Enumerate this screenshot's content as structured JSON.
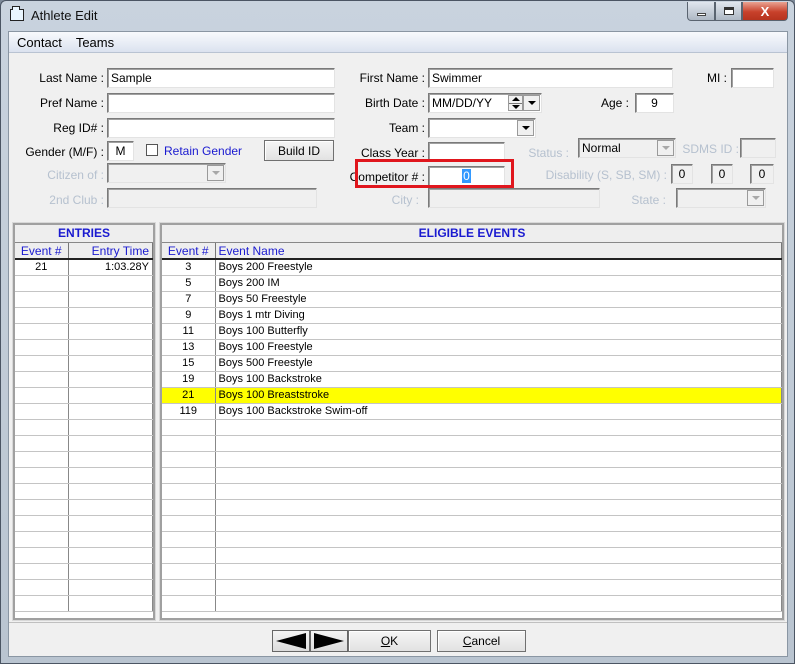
{
  "window": {
    "title": "Athlete Edit",
    "icon": "folder-window-icon",
    "controls": [
      "minimize-icon",
      "maximize-icon",
      "close-icon"
    ],
    "close_glyph": "X"
  },
  "menu": [
    {
      "label": "Contact"
    },
    {
      "label": "Teams"
    }
  ],
  "form": {
    "last_name": {
      "label": "Last Name :",
      "value": "Sample"
    },
    "first_name": {
      "label": "First Name :",
      "value": "Swimmer"
    },
    "mi": {
      "label": "MI :",
      "value": ""
    },
    "pref_name": {
      "label": "Pref Name :",
      "value": ""
    },
    "birth_date": {
      "label": "Birth Date :",
      "value": "MM/DD/YY"
    },
    "age": {
      "label": "Age :",
      "value": "9"
    },
    "reg_id": {
      "label": "Reg ID# :",
      "value": ""
    },
    "team": {
      "label": "Team :",
      "value": ""
    },
    "gender": {
      "label": "Gender (M/F) :",
      "value": "M"
    },
    "retain_gender": {
      "label": "Retain Gender",
      "checked": false
    },
    "build_id": {
      "label": "Build ID"
    },
    "class_year": {
      "label": "Class Year :",
      "value": ""
    },
    "status": {
      "label": "Status :",
      "value": "Normal",
      "disabled": true
    },
    "sdms_id": {
      "label": "SDMS ID :",
      "value": "",
      "disabled": true
    },
    "citizen_of": {
      "label": "Citizen of :",
      "value": "",
      "disabled": true
    },
    "competitor": {
      "label": "Competitor # :",
      "value": "0",
      "highlight_color": "#e0161d"
    },
    "disability": {
      "label": "Disability (S, SB, SM) :",
      "values": [
        "0",
        "0",
        "0"
      ],
      "disabled": true
    },
    "second_club": {
      "label": "2nd Club :",
      "value": "",
      "disabled": true
    },
    "city": {
      "label": "City :",
      "value": "",
      "disabled": true
    },
    "state": {
      "label": "State :",
      "value": "",
      "disabled": true
    }
  },
  "entries": {
    "title": "ENTRIES",
    "columns": [
      "Event #",
      "Entry Time"
    ],
    "rows": [
      {
        "event": "21",
        "time": "1:03.28Y"
      }
    ]
  },
  "eligible": {
    "title": "ELIGIBLE EVENTS",
    "columns": [
      "Event #",
      "Event Name"
    ],
    "highlight_color": "#ffff00",
    "rows": [
      {
        "event": "3",
        "name": "Boys 200 Freestyle",
        "highlighted": false
      },
      {
        "event": "5",
        "name": "Boys 200 IM",
        "highlighted": false
      },
      {
        "event": "7",
        "name": "Boys 50 Freestyle",
        "highlighted": false
      },
      {
        "event": "9",
        "name": "Boys 1 mtr Diving",
        "highlighted": false
      },
      {
        "event": "11",
        "name": "Boys 100 Butterfly",
        "highlighted": false
      },
      {
        "event": "13",
        "name": "Boys 100 Freestyle",
        "highlighted": false
      },
      {
        "event": "15",
        "name": "Boys 500 Freestyle",
        "highlighted": false
      },
      {
        "event": "19",
        "name": "Boys 100 Backstroke",
        "highlighted": false
      },
      {
        "event": "21",
        "name": "Boys 100 Breaststroke",
        "highlighted": true
      },
      {
        "event": "119",
        "name": "Boys 100 Backstroke Swim-off",
        "highlighted": false
      }
    ]
  },
  "footer": {
    "prev_icon": "arrow-left-icon",
    "next_icon": "arrow-right-icon",
    "ok_label": "OK",
    "ok_accel": "O",
    "ok_rest": "K",
    "cancel_label": "Cancel",
    "cancel_accel": "C",
    "cancel_rest": "ancel"
  }
}
